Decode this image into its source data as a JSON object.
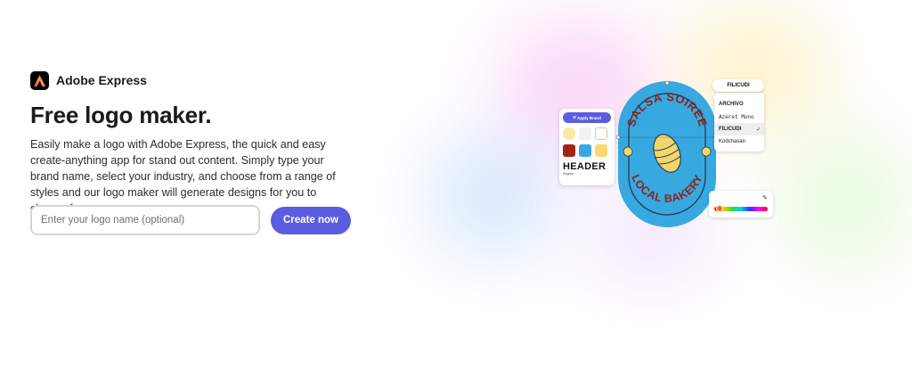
{
  "brand": {
    "name": "Adobe Express",
    "logo_icon": "adobe-express-logo-icon"
  },
  "hero": {
    "title": "Free logo maker.",
    "description": "Easily make a logo with Adobe Express, the quick and easy create-anything app for stand out content. Simply type your brand name, select your industry, and choose from a range of styles and our logo maker will generate designs for you to choose from."
  },
  "form": {
    "input_placeholder": "Enter your logo name (optional)",
    "input_value": "",
    "create_label": "Create now"
  },
  "illustration": {
    "logo_top_text": "SALSA SOIREE",
    "logo_bottom_text": "LOCAL BAKERY",
    "apply_label": "Apply Brand",
    "header_label": "HEADER",
    "header_sub": "Regular",
    "font_pill": "FILICUDI",
    "font_options": [
      "ARCHIVO",
      "Azeret Mono",
      "FILICUDI",
      "Kodchasan"
    ],
    "selected_font": "FILICUDI",
    "check_glyph": "✓",
    "colors": {
      "accent": "#5c5ce0",
      "badge_fill": "#37a9e0",
      "badge_text": "#8b2416",
      "croissant": "#f5d66b"
    }
  }
}
